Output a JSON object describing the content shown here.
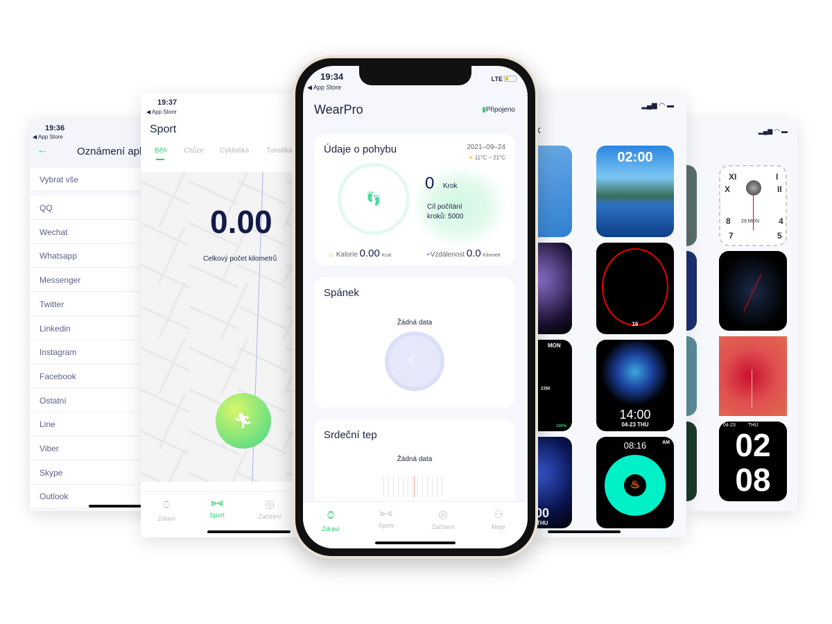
{
  "notifications_screen": {
    "time": "19:36",
    "back": "◀ App Store",
    "title": "Oznámení apli",
    "select_all": "Vybrat vše",
    "apps": [
      "QQ",
      "Wechat",
      "Whatsapp",
      "Messenger",
      "Twitter",
      "Linkedin",
      "Instagram",
      "Facebook",
      "Ostatní",
      "Line",
      "Viber",
      "Skype",
      "Outlook"
    ]
  },
  "sport_screen": {
    "time": "19:37",
    "back": "◀ App Store",
    "title": "Sport",
    "tabs": [
      "Běh",
      "Chůze",
      "Cyklistika",
      "Turistika"
    ],
    "active_tab": "Běh",
    "distance": "0.00",
    "distance_label": "Celkový počet kilometrů",
    "nav": [
      {
        "label": "Zdraví",
        "icon": "watch-icon"
      },
      {
        "label": "Sport",
        "icon": "dumbbell-icon"
      },
      {
        "label": "Zařízení",
        "icon": "device-icon"
      }
    ],
    "active_nav": "Sport"
  },
  "main_screen": {
    "time": "19:34",
    "back": "◀ App Store",
    "network": "LTE",
    "app_title": "WearPro",
    "connection": "Připojeno",
    "activity": {
      "title": "Údaje o pohybu",
      "date": "2021–09–24",
      "weather": "11°C ~ 21°C",
      "steps": "0",
      "steps_unit": "Krok",
      "goal_line1": "Cíl počítání",
      "goal_line2": "kroků: 5000",
      "calories_label": "Kalorie",
      "calories": "0.00",
      "calories_unit": "Kcal",
      "distance_label": "Vzdálenost",
      "distance": "0.0",
      "distance_unit": "Kilometr"
    },
    "sleep": {
      "title": "Spánek",
      "empty": "Žádná data"
    },
    "heart": {
      "title": "Srdeční tep",
      "empty": "Žádná data"
    },
    "nav": [
      {
        "label": "Zdraví",
        "icon": "watch-icon"
      },
      {
        "label": "Sport",
        "icon": "dumbbell-icon"
      },
      {
        "label": "Zařízení",
        "icon": "device-icon"
      },
      {
        "label": "Moje",
        "icon": "user-icon"
      }
    ],
    "active_nav": "Zdraví"
  },
  "dials_screen": {
    "title_fragment": "ík",
    "faces": [
      "02:00",
      "16",
      "14:00",
      "04-23  THU",
      "08:16",
      "AM",
      "MON",
      "2356",
      "100%",
      "00",
      "THU"
    ]
  },
  "dials_screen_2": {
    "faces": [
      "XI",
      "I",
      "X",
      "II",
      "8",
      "4",
      "7",
      "5",
      "29 MON",
      "04-23",
      "THU",
      "02",
      "08"
    ]
  },
  "colors": {
    "accent": "#2ecc71",
    "text_dark": "#1c2340",
    "list_text": "#5b5f8a"
  }
}
